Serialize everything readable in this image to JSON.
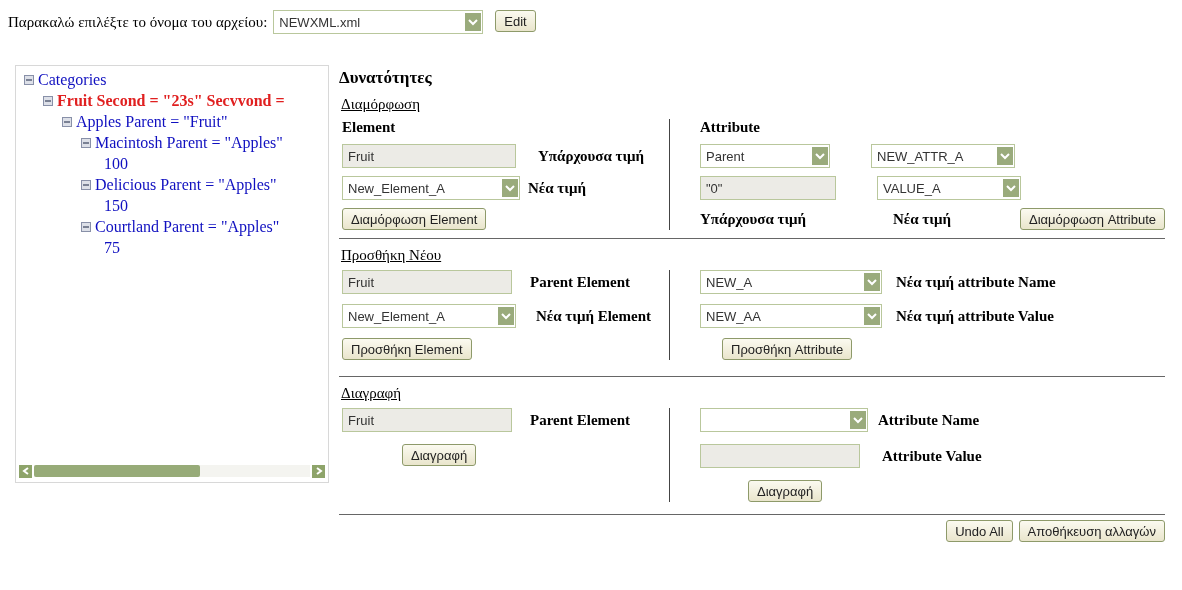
{
  "file_picker": {
    "label": "Παρακαλώ επιλέξτε το όνομα του αρχείου:",
    "value": "NEWXML.xml",
    "button": "Edit"
  },
  "tree": {
    "items": [
      {
        "kind": "node",
        "label": "Categories",
        "expanded": true,
        "selected": false,
        "children": [
          {
            "kind": "node",
            "label": "Fruit Second = \"23s\" Secvvond =",
            "expanded": true,
            "selected": true,
            "children": [
              {
                "kind": "node",
                "label": "Apples Parent = \"Fruit\"",
                "expanded": true,
                "selected": false,
                "children": [
                  {
                    "kind": "node",
                    "label": "Macintosh Parent = \"Apples\"",
                    "expanded": true,
                    "selected": false,
                    "children": [
                      {
                        "kind": "value",
                        "label": "100",
                        "selected": false
                      }
                    ]
                  },
                  {
                    "kind": "node",
                    "label": "Delicious Parent = \"Apples\"",
                    "expanded": true,
                    "selected": false,
                    "children": [
                      {
                        "kind": "value",
                        "label": "150",
                        "selected": false
                      }
                    ]
                  },
                  {
                    "kind": "node",
                    "label": "Courtland Parent = \"Apples\"",
                    "expanded": true,
                    "selected": false,
                    "children": [
                      {
                        "kind": "value",
                        "label": "75",
                        "selected": false
                      }
                    ]
                  }
                ]
              }
            ]
          }
        ]
      }
    ]
  },
  "options": {
    "title": "Δυνατότητες",
    "configure": {
      "title": "Διαμόρφωση",
      "element": {
        "heading": "Element",
        "current_value": "Fruit",
        "current_label": "Υπάρχουσα τιμή",
        "new_value": "New_Element_A",
        "new_label": "Νέα τιμή",
        "button": "Διαμόρφωση Element"
      },
      "attribute": {
        "heading": "Attribute",
        "name_current": "Parent",
        "name_new": "NEW_ATTR_A",
        "value_current": "\"0\"",
        "value_new": "VALUE_A",
        "current_label": "Υπάρχουσα τιμή",
        "new_label": "Νέα τιμή",
        "button": "Διαμόρφωση Attribute"
      }
    },
    "add": {
      "title": "Προσθήκη Νέου",
      "element": {
        "parent_value": "Fruit",
        "parent_label": "Parent Element",
        "new_value": "New_Element_A",
        "new_label": "Νέα τιμή Element",
        "button": "Προσθήκη Element"
      },
      "attribute": {
        "name_value": "NEW_A",
        "name_label": "Νέα τιμή attribute Name",
        "value_value": "NEW_AA",
        "value_label": "Νέα τιμή attribute Value",
        "button": "Προσθήκη Attribute"
      }
    },
    "delete": {
      "title": "Διαγραφή",
      "element": {
        "parent_value": "Fruit",
        "parent_label": "Parent Element",
        "button": "Διαγραφή"
      },
      "attribute": {
        "name_label": "Attribute Name",
        "value_label": "Attribute Value",
        "button": "Διαγραφή"
      }
    }
  },
  "footer_buttons": [
    "Undo All",
    "Αποθήκευση αλλαγών"
  ]
}
